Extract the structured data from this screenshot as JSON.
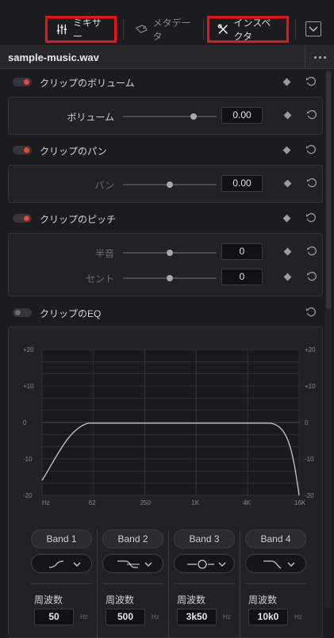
{
  "toolbar": {
    "mixer_label": "ミキサー",
    "metadata_label": "メタデータ",
    "inspector_label": "インスペクタ"
  },
  "header": {
    "file_name": "sample-music.wav"
  },
  "sections": {
    "volume": {
      "title": "クリップのボリューム",
      "row_label": "ボリューム",
      "value": "0.00",
      "slider_pos": 0.75
    },
    "pan": {
      "title": "クリップのパン",
      "row_label": "パン",
      "value": "0.00",
      "slider_pos": 0.5
    },
    "pitch": {
      "title": "クリップのピッチ",
      "semitone_label": "半音",
      "semitone_value": "0",
      "semitone_pos": 0.5,
      "cent_label": "セント",
      "cent_value": "0",
      "cent_pos": 0.5
    },
    "eq": {
      "title": "クリップのEQ",
      "y_ticks": [
        "+20",
        "+10",
        "0",
        "-10",
        "-20"
      ],
      "x_ticks": [
        "Hz",
        "62",
        "250",
        "1K",
        "4K",
        "16K"
      ],
      "bands": [
        {
          "label": "Band 1",
          "shape": "low-shelf-icon",
          "freq_label": "周波数",
          "freq": "50",
          "unit": "Hz"
        },
        {
          "label": "Band 2",
          "shape": "bell-icon",
          "freq_label": "周波数",
          "freq": "500",
          "unit": "Hz"
        },
        {
          "label": "Band 3",
          "shape": "bell-icon",
          "freq_label": "周波数",
          "freq": "3k50",
          "unit": "Hz"
        },
        {
          "label": "Band 4",
          "shape": "high-shelf-icon",
          "freq_label": "周波数",
          "freq": "10k0",
          "unit": "Hz"
        }
      ]
    }
  },
  "colors": {
    "accent_red": "#e8141c",
    "toggle_on": "#e04b3e",
    "background": "#1c1c1f"
  }
}
